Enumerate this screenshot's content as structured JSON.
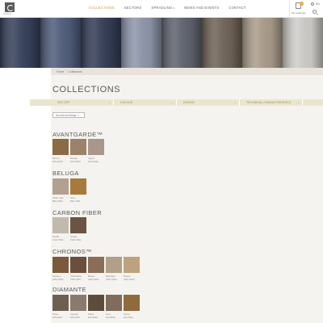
{
  "header": {
    "logo_text": "SAHCO",
    "nav": [
      {
        "label": "COLLECTIONS",
        "active": true,
        "caret": false
      },
      {
        "label": "SECTORS",
        "active": false,
        "caret": false
      },
      {
        "label": "SPRADLING",
        "active": false,
        "caret": true
      },
      {
        "label": "NEWS AND EVENTS",
        "active": false,
        "caret": false
      },
      {
        "label": "CONTACT",
        "active": false,
        "caret": false
      }
    ],
    "catalogue_count": "0",
    "catalogue_label": "My catalogue",
    "language": "EN"
  },
  "breadcrumb": {
    "home": "Home",
    "separator": "/",
    "current": "Collections"
  },
  "page_title": "COLLECTIONS",
  "filters": [
    {
      "label": "SECTOR"
    },
    {
      "label": "COLOUR"
    },
    {
      "label": "DESIGN"
    },
    {
      "label": "TECHNICAL CHARACTERISTICS"
    }
  ],
  "active_filter_tag": "Neutral and Beige",
  "active_filter_remove": "x",
  "colors": {
    "accent": "#c89a4a",
    "filter_bar": "#eae6cd",
    "content_bg": "#f5f3ef"
  },
  "collections": [
    {
      "name": "AVANTGARDE™",
      "swatches": [
        {
          "name": "Bronce",
          "code": "AVG-0003",
          "color": "#8b6a44"
        },
        {
          "name": "Brindle",
          "code": "AVG-0004",
          "color": "#9b8268"
        },
        {
          "name": "Argent",
          "code": "AVG-0002",
          "color": "#a8978a"
        }
      ]
    },
    {
      "name": "BELUGA",
      "swatches": [
        {
          "name": "White Clay",
          "code": "BEL-0003",
          "color": "#b2a190"
        },
        {
          "name": "Ocre",
          "code": "BEL-1001",
          "color": "#a77a3c"
        }
      ]
    },
    {
      "name": "CARBON FIBER",
      "swatches": [
        {
          "name": "Vanilla",
          "code": "CAR-7003",
          "color": "#c2b9ad"
        },
        {
          "name": "Ginger",
          "code": "CAR-7001",
          "color": "#6c5444"
        }
      ]
    },
    {
      "name": "CHRONOS™",
      "swatches": [
        {
          "name": "Sesamo",
          "code": "CRO-0004",
          "color": "#7b5a3a"
        },
        {
          "name": "Chihuahua",
          "code": "CRO-0007",
          "color": "#6b4f3d"
        },
        {
          "name": "Biscuit",
          "code": "CRO-0006",
          "color": "#8a6e55"
        },
        {
          "name": "Marzipan",
          "code": "CRO-0002",
          "color": "#b0a08a"
        },
        {
          "name": "Biscuit",
          "code": "CRO-0003",
          "color": "#bda27e"
        }
      ]
    },
    {
      "name": "DIAMANTE",
      "swatches": [
        {
          "name": "Taupe",
          "code": "DIA-0003",
          "color": "#6e5f53"
        },
        {
          "name": "Capucci",
          "code": "DIA-0004",
          "color": "#8a7a6d"
        },
        {
          "name": "Dante",
          "code": "DIA-9003",
          "color": "#5e4c3b"
        },
        {
          "name": "Ivory",
          "code": "DIA-9002",
          "color": "#7f6c5d"
        },
        {
          "name": "Honey",
          "code": "DIA-0002",
          "color": "#8f6a3c"
        }
      ]
    }
  ],
  "hero_fabrics": [
    {
      "color": "#2f3a55"
    },
    {
      "color": "#4a5878"
    },
    {
      "color": "#2c3650"
    },
    {
      "color": "#8b93a8"
    },
    {
      "color": "#5a5e6a"
    },
    {
      "color": "#6b5e52"
    },
    {
      "color": "#a89a88"
    },
    {
      "color": "#cfcdc8"
    }
  ]
}
